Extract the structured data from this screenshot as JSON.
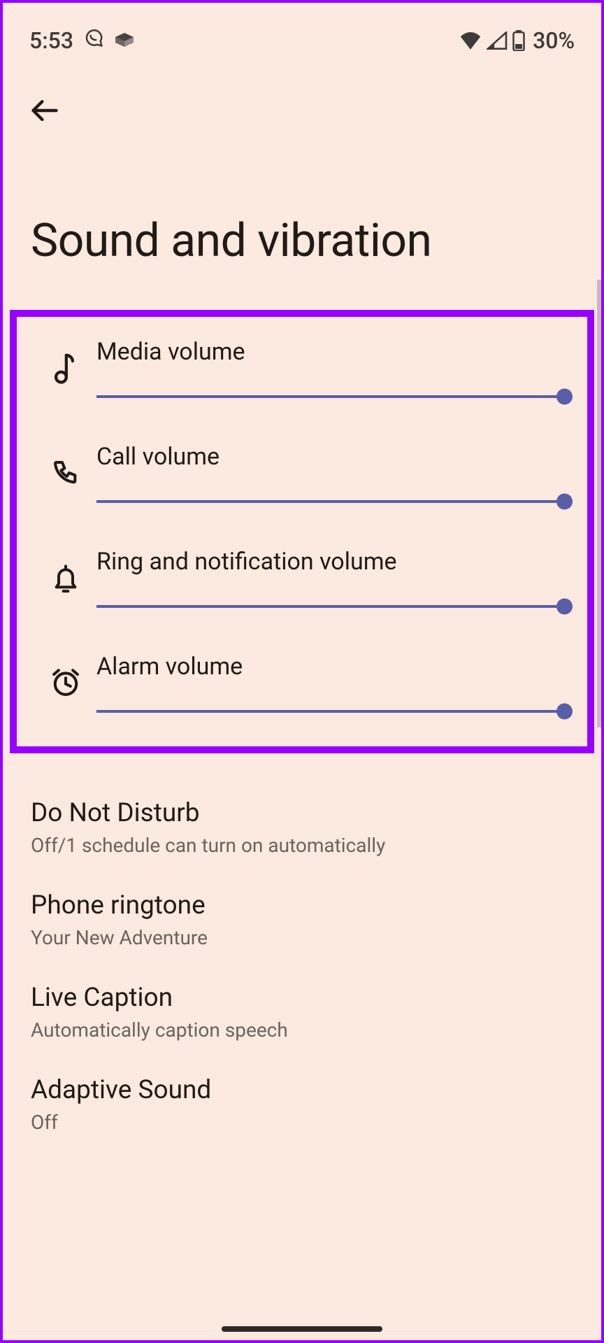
{
  "status": {
    "time": "5:53",
    "battery_text": "30%"
  },
  "page": {
    "title": "Sound and vibration"
  },
  "sliders": [
    {
      "label": "Media volume",
      "icon": "music-note-icon",
      "value_pct": 100
    },
    {
      "label": "Call volume",
      "icon": "phone-icon",
      "value_pct": 100
    },
    {
      "label": "Ring and notification volume",
      "icon": "bell-icon",
      "value_pct": 100
    },
    {
      "label": "Alarm volume",
      "icon": "alarm-icon",
      "value_pct": 100
    }
  ],
  "items": [
    {
      "title": "Do Not Disturb",
      "sub": "Off/1 schedule can turn on automatically"
    },
    {
      "title": "Phone ringtone",
      "sub": "Your New Adventure"
    },
    {
      "title": "Live Caption",
      "sub": "Automatically caption speech"
    },
    {
      "title": "Adaptive Sound",
      "sub": "Off"
    }
  ]
}
